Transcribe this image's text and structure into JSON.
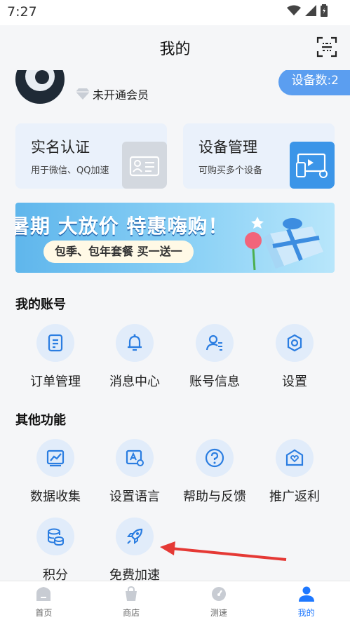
{
  "status": {
    "time": "7:27"
  },
  "header": {
    "title": "我的",
    "scan_icon": "scan-icon"
  },
  "profile": {
    "vip_label": "未开通会员",
    "device_count": "设备数:2"
  },
  "cards": [
    {
      "title": "实名认证",
      "subtitle": "用于微信、QQ加速",
      "icon": "id-card-icon"
    },
    {
      "title": "设备管理",
      "subtitle": "可购买多个设备",
      "icon": "device-manage-icon"
    }
  ],
  "banner": {
    "headline": "暑期 大放价 特惠嗨购！",
    "pill": "包季、包年套餐 买一送一"
  },
  "my_account": {
    "title": "我的账号",
    "items": [
      {
        "label": "订单管理",
        "icon": "order-icon"
      },
      {
        "label": "消息中心",
        "icon": "bell-icon"
      },
      {
        "label": "账号信息",
        "icon": "account-icon"
      },
      {
        "label": "设置",
        "icon": "settings-icon"
      }
    ]
  },
  "other_features": {
    "title": "其他功能",
    "items": [
      {
        "label": "数据收集",
        "icon": "chart-icon"
      },
      {
        "label": "设置语言",
        "icon": "language-icon"
      },
      {
        "label": "帮助与反馈",
        "icon": "help-icon"
      },
      {
        "label": "推广返利",
        "icon": "promo-icon"
      },
      {
        "label": "积分",
        "icon": "points-icon"
      },
      {
        "label": "免费加速",
        "icon": "rocket-icon"
      }
    ]
  },
  "tabbar": {
    "tabs": [
      {
        "label": "首页",
        "icon": "home-icon"
      },
      {
        "label": "商店",
        "icon": "store-icon"
      },
      {
        "label": "测速",
        "icon": "speedometer-icon"
      },
      {
        "label": "我的",
        "icon": "profile-icon"
      }
    ],
    "active_index": 3
  },
  "colors": {
    "accent": "#1e78ff",
    "icon_bg": "#e1ecfa",
    "icon_stroke": "#2a7de1",
    "badge": "#5b9ef0"
  }
}
